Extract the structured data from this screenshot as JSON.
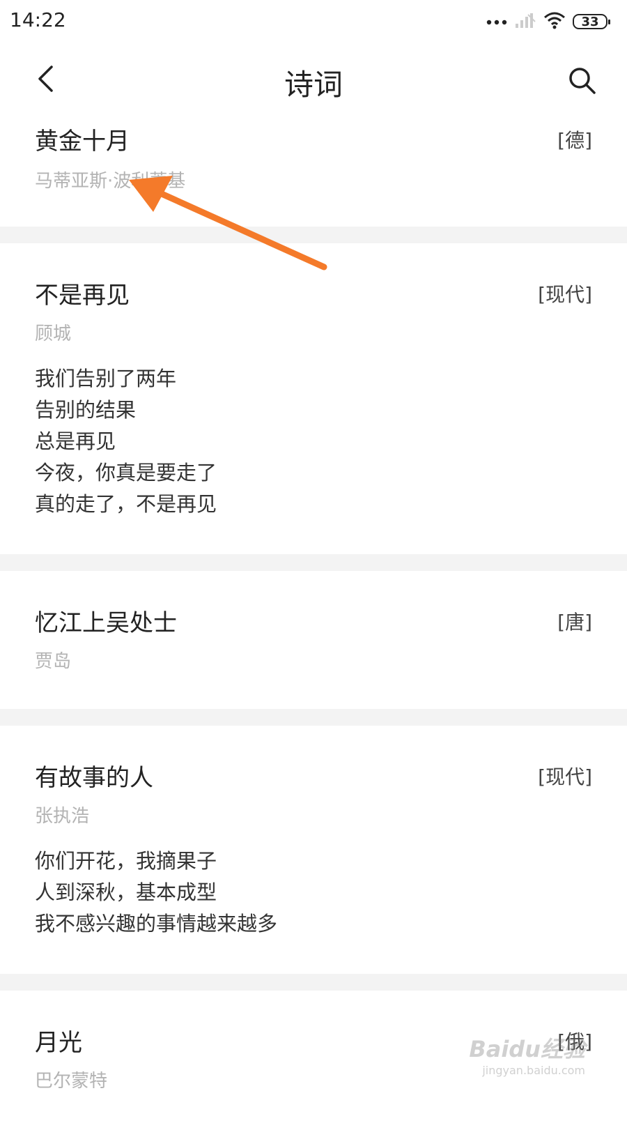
{
  "status_bar": {
    "time": "14:22",
    "battery": "33"
  },
  "nav": {
    "title": "诗词"
  },
  "poems": [
    {
      "title": "黄金十月",
      "dynasty": "[德]",
      "author": "马蒂亚斯·波利蒂基",
      "lines": []
    },
    {
      "title": "不是再见",
      "dynasty": "[现代]",
      "author": "顾城",
      "lines": [
        "我们告别了两年",
        "告别的结果",
        "总是再见",
        "今夜，你真是要走了",
        "真的走了，不是再见"
      ]
    },
    {
      "title": "忆江上吴处士",
      "dynasty": "[唐]",
      "author": "贾岛",
      "lines": []
    },
    {
      "title": "有故事的人",
      "dynasty": "[现代]",
      "author": "张执浩",
      "lines": [
        "你们开花，我摘果子",
        "人到深秋，基本成型",
        "我不感兴趣的事情越来越多"
      ]
    },
    {
      "title": "月光",
      "dynasty": "[俄]",
      "author": "巴尔蒙特",
      "lines": []
    }
  ],
  "watermark": {
    "brand": "Baidu经验",
    "url": "jingyan.baidu.com"
  },
  "colors": {
    "annotation_arrow": "#f47a2a",
    "separator": "#f3f3f3",
    "author_gray": "#b3b3b3"
  },
  "icons": {
    "back": "chevron-left-icon",
    "search": "search-icon"
  }
}
